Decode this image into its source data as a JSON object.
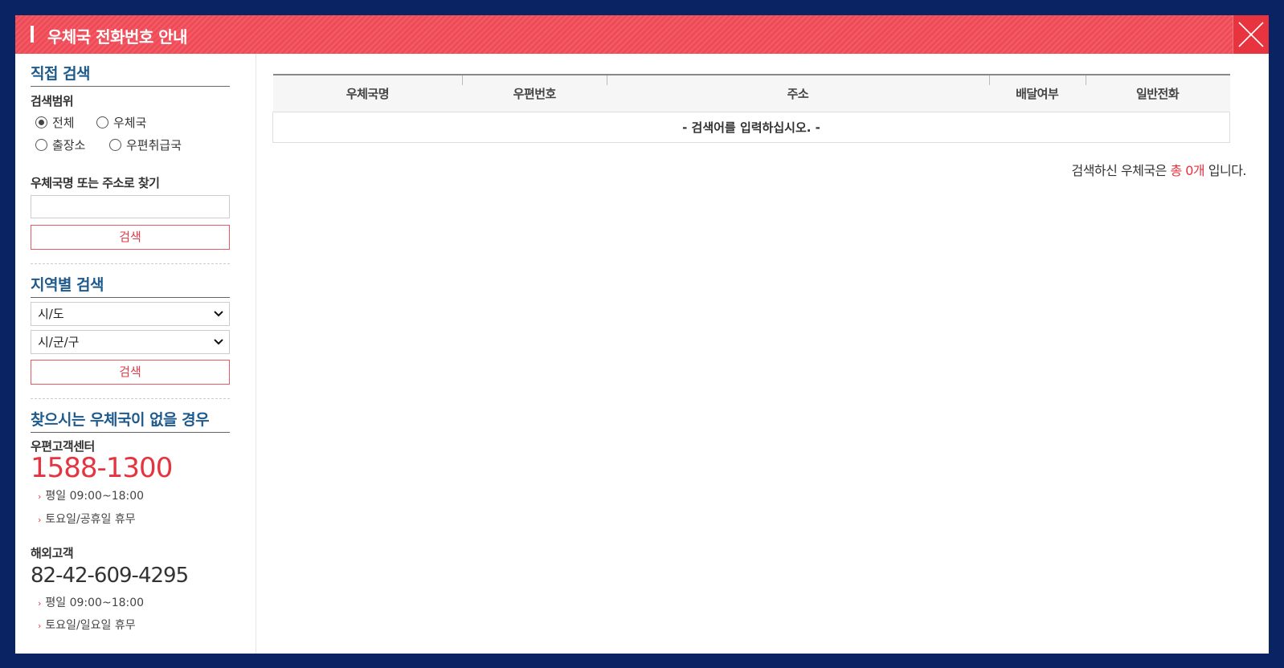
{
  "window": {
    "title": "우체국 전화번호 안내"
  },
  "direct_search": {
    "title": "직접 검색",
    "range_label": "검색범위",
    "options": [
      "전체",
      "우체국",
      "출장소",
      "우편취급국"
    ],
    "selected": "전체",
    "name_label": "우체국명 또는 주소로 찾기",
    "input_value": "",
    "button_label": "검색"
  },
  "region_search": {
    "title": "지역별 검색",
    "sido_value": "시/도",
    "sigungu_value": "시/군/구",
    "button_label": "검색"
  },
  "no_office": {
    "title": "찾으시는 우체국이 없을 경우",
    "center_label": "우편고객센터",
    "center_phone": "1588-1300",
    "center_hours": "평일 09:00~18:00",
    "center_closed": "토요일/공휴일 휴무",
    "overseas_label": "해외고객",
    "overseas_phone": "82-42-609-4295",
    "overseas_hours": "평일 09:00~18:00",
    "overseas_closed": "토요일/일요일 휴무"
  },
  "results_table": {
    "columns": [
      "우체국명",
      "우편번호",
      "주소",
      "배달여부",
      "일반전화"
    ],
    "empty_message": "- 검색어를 입력하십시오. -"
  },
  "result_summary": {
    "prefix": "검색하신 우체국은",
    "count_text": "총 0개",
    "suffix": "입니다."
  },
  "colors": {
    "accent": "#ef4a56",
    "frame": "#0a2463",
    "section_title": "#1f5a8c"
  }
}
